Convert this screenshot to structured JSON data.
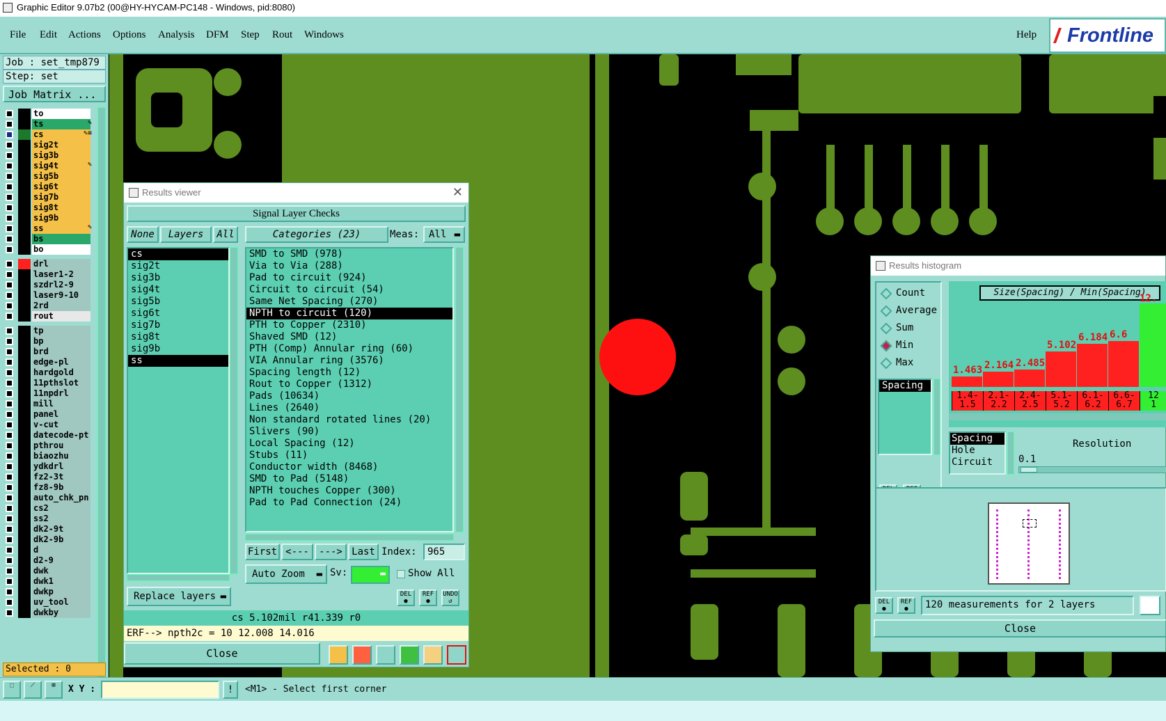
{
  "window": {
    "title": "Graphic Editor 9.07b2 (00@HY-HYCAM-PC148 - Windows, pid:8080)"
  },
  "menu": {
    "items": [
      "File",
      "Edit",
      "Actions",
      "Options",
      "Analysis",
      "DFM",
      "Step",
      "Rout",
      "Windows"
    ],
    "help": "Help",
    "logo": "Frontline"
  },
  "job": {
    "job_label": "Job : set_tmp879",
    "step_label": "Step: set",
    "matrix_button": "Job Matrix ..."
  },
  "layers": [
    {
      "name": "to",
      "color": "#ffffff",
      "mark": "",
      "flag": ""
    },
    {
      "name": "ts",
      "color": "#2aa86a",
      "mark": "",
      "flag": "✎"
    },
    {
      "name": "cs",
      "color": "#f4c048",
      "mark": "#1a7a2a",
      "flag": "✎≡"
    },
    {
      "name": "sig2t",
      "color": "#f4c048",
      "mark": "",
      "flag": ""
    },
    {
      "name": "sig3b",
      "color": "#f4c048",
      "mark": "",
      "flag": ""
    },
    {
      "name": "sig4t",
      "color": "#f4c048",
      "mark": "",
      "flag": "✎"
    },
    {
      "name": "sig5b",
      "color": "#f4c048",
      "mark": "",
      "flag": ""
    },
    {
      "name": "sig6t",
      "color": "#f4c048",
      "mark": "",
      "flag": ""
    },
    {
      "name": "sig7b",
      "color": "#f4c048",
      "mark": "",
      "flag": ""
    },
    {
      "name": "sig8t",
      "color": "#f4c048",
      "mark": "",
      "flag": ""
    },
    {
      "name": "sig9b",
      "color": "#f4c048",
      "mark": "",
      "flag": ""
    },
    {
      "name": "ss",
      "color": "#f4c048",
      "mark": "",
      "flag": "✎"
    },
    {
      "name": "bs",
      "color": "#2aa86a",
      "mark": "",
      "flag": ""
    },
    {
      "name": "bo",
      "color": "#ffffff",
      "mark": "",
      "flag": ""
    },
    {
      "name": "drl",
      "color": "#a0c8c0",
      "mark": "#ff2020",
      "flag": ""
    },
    {
      "name": "laser1-2",
      "color": "#a0c8c0",
      "mark": "",
      "flag": ""
    },
    {
      "name": "szdrl2-9",
      "color": "#a0c8c0",
      "mark": "",
      "flag": ""
    },
    {
      "name": "laser9-10",
      "color": "#a0c8c0",
      "mark": "",
      "flag": ""
    },
    {
      "name": "2rd",
      "color": "#a0c8c0",
      "mark": "",
      "flag": ""
    },
    {
      "name": "rout",
      "color": "#e8e8e8",
      "mark": "",
      "flag": ""
    },
    {
      "name": "tp",
      "color": "#a0c8c0",
      "mark": "",
      "flag": ""
    },
    {
      "name": "bp",
      "color": "#a0c8c0",
      "mark": "",
      "flag": ""
    },
    {
      "name": "brd",
      "color": "#a0c8c0",
      "mark": "",
      "flag": ""
    },
    {
      "name": "edge-pl",
      "color": "#a0c8c0",
      "mark": "",
      "flag": ""
    },
    {
      "name": "hardgold",
      "color": "#a0c8c0",
      "mark": "",
      "flag": ""
    },
    {
      "name": "11pthslot",
      "color": "#a0c8c0",
      "mark": "",
      "flag": ""
    },
    {
      "name": "11npdrl",
      "color": "#a0c8c0",
      "mark": "",
      "flag": ""
    },
    {
      "name": "mill",
      "color": "#a0c8c0",
      "mark": "",
      "flag": ""
    },
    {
      "name": "panel",
      "color": "#a0c8c0",
      "mark": "",
      "flag": ""
    },
    {
      "name": "v-cut",
      "color": "#a0c8c0",
      "mark": "",
      "flag": ""
    },
    {
      "name": "datecode-pt",
      "color": "#a0c8c0",
      "mark": "",
      "flag": ""
    },
    {
      "name": "pthrou",
      "color": "#a0c8c0",
      "mark": "",
      "flag": ""
    },
    {
      "name": "biaozhu",
      "color": "#a0c8c0",
      "mark": "",
      "flag": ""
    },
    {
      "name": "ydkdrl",
      "color": "#a0c8c0",
      "mark": "",
      "flag": ""
    },
    {
      "name": "fz2-3t",
      "color": "#a0c8c0",
      "mark": "",
      "flag": ""
    },
    {
      "name": "fz8-9b",
      "color": "#a0c8c0",
      "mark": "",
      "flag": ""
    },
    {
      "name": "auto_chk_pn",
      "color": "#a0c8c0",
      "mark": "",
      "flag": ""
    },
    {
      "name": "cs2",
      "color": "#a0c8c0",
      "mark": "",
      "flag": ""
    },
    {
      "name": "ss2",
      "color": "#a0c8c0",
      "mark": "",
      "flag": ""
    },
    {
      "name": "dk2-9t",
      "color": "#a0c8c0",
      "mark": "",
      "flag": ""
    },
    {
      "name": "dk2-9b",
      "color": "#a0c8c0",
      "mark": "",
      "flag": ""
    },
    {
      "name": "d",
      "color": "#a0c8c0",
      "mark": "",
      "flag": ""
    },
    {
      "name": "d2-9",
      "color": "#a0c8c0",
      "mark": "",
      "flag": ""
    },
    {
      "name": "dwk",
      "color": "#a0c8c0",
      "mark": "",
      "flag": ""
    },
    {
      "name": "dwk1",
      "color": "#a0c8c0",
      "mark": "",
      "flag": ""
    },
    {
      "name": "dwkp",
      "color": "#a0c8c0",
      "mark": "",
      "flag": ""
    },
    {
      "name": "uv_tool",
      "color": "#a0c8c0",
      "mark": "",
      "flag": ""
    },
    {
      "name": "dwkby",
      "color": "#a0c8c0",
      "mark": "",
      "flag": ""
    }
  ],
  "selected": "Selected : 0",
  "results_viewer": {
    "title": "Results viewer",
    "header": "Signal Layer Checks",
    "none": "None",
    "layers_btn": "Layers",
    "all": "All",
    "categories_btn": "Categories (23)",
    "meas_label": "Meas:",
    "meas_value": "All",
    "layer_list": [
      "cs",
      "sig2t",
      "sig3b",
      "sig4t",
      "sig5b",
      "sig6t",
      "sig7b",
      "sig8t",
      "sig9b",
      "ss"
    ],
    "categories": [
      "SMD to SMD (978)",
      "Via to Via (288)",
      "Pad to circuit (924)",
      "Circuit to circuit (54)",
      "Same Net Spacing (270)",
      "NPTH to circuit (120)",
      "PTH to Copper (2310)",
      "Shaved SMD (12)",
      "PTH (Comp) Annular ring (60)",
      "VIA Annular ring (3576)",
      "Spacing length (12)",
      "Rout to Copper (1312)",
      "Pads (10634)",
      "Lines (2640)",
      "Non standard rotated lines (20)",
      "Slivers (90)",
      "Local Spacing (12)",
      "Stubs (11)",
      "Conductor width (8468)",
      "SMD to Pad (5148)",
      "NPTH touches Copper (300)",
      "Pad to Pad Connection (24)"
    ],
    "first": "First",
    "prev": "<---",
    "next": "--->",
    "last": "Last",
    "index_label": "Index:",
    "index_value": "965",
    "auto_zoom": "Auto Zoom",
    "sv": "Sv:",
    "show_all": "Show All",
    "replace_layers": "Replace layers",
    "del": "DEL",
    "ref": "REF",
    "undo": "UNDO",
    "info": "cs 5.102mil  r41.339  r0",
    "erf": "ERF--> npth2c = 10 12.008 14.016",
    "close": "Close"
  },
  "histogram": {
    "title": "Results histogram",
    "options": [
      "Count",
      "Average",
      "Sum",
      "Min",
      "Max"
    ],
    "selected_option": "Min",
    "list": [
      "Spacing"
    ],
    "chart_title": "Size(Spacing) / Min(Spacing)",
    "bars": [
      {
        "value": "1.463",
        "l1": "1.4-",
        "l2": "1.5",
        "h": 1.463
      },
      {
        "value": "2.164",
        "l1": "2.1-",
        "l2": "2.2",
        "h": 2.164
      },
      {
        "value": "2.485",
        "l1": "2.4-",
        "l2": "2.5",
        "h": 2.485
      },
      {
        "value": "5.102",
        "l1": "5.1-",
        "l2": "5.2",
        "h": 5.102
      },
      {
        "value": "6.184",
        "l1": "6.1-",
        "l2": "6.2",
        "h": 6.184
      },
      {
        "value": "6.6",
        "l1": "6.6-",
        "l2": "6.7",
        "h": 6.6
      }
    ],
    "last_value": "12.",
    "last_label": "12",
    "last_label2": "1",
    "types": [
      "Spacing",
      "Hole",
      "Circuit"
    ],
    "resolution_label": "Resolution",
    "resolution_value": "0.1",
    "measurements": "120 measurements for 2 layers",
    "close": "Close"
  },
  "status": {
    "xy_label": "X Y :",
    "message": "<M1> - Select first corner"
  }
}
